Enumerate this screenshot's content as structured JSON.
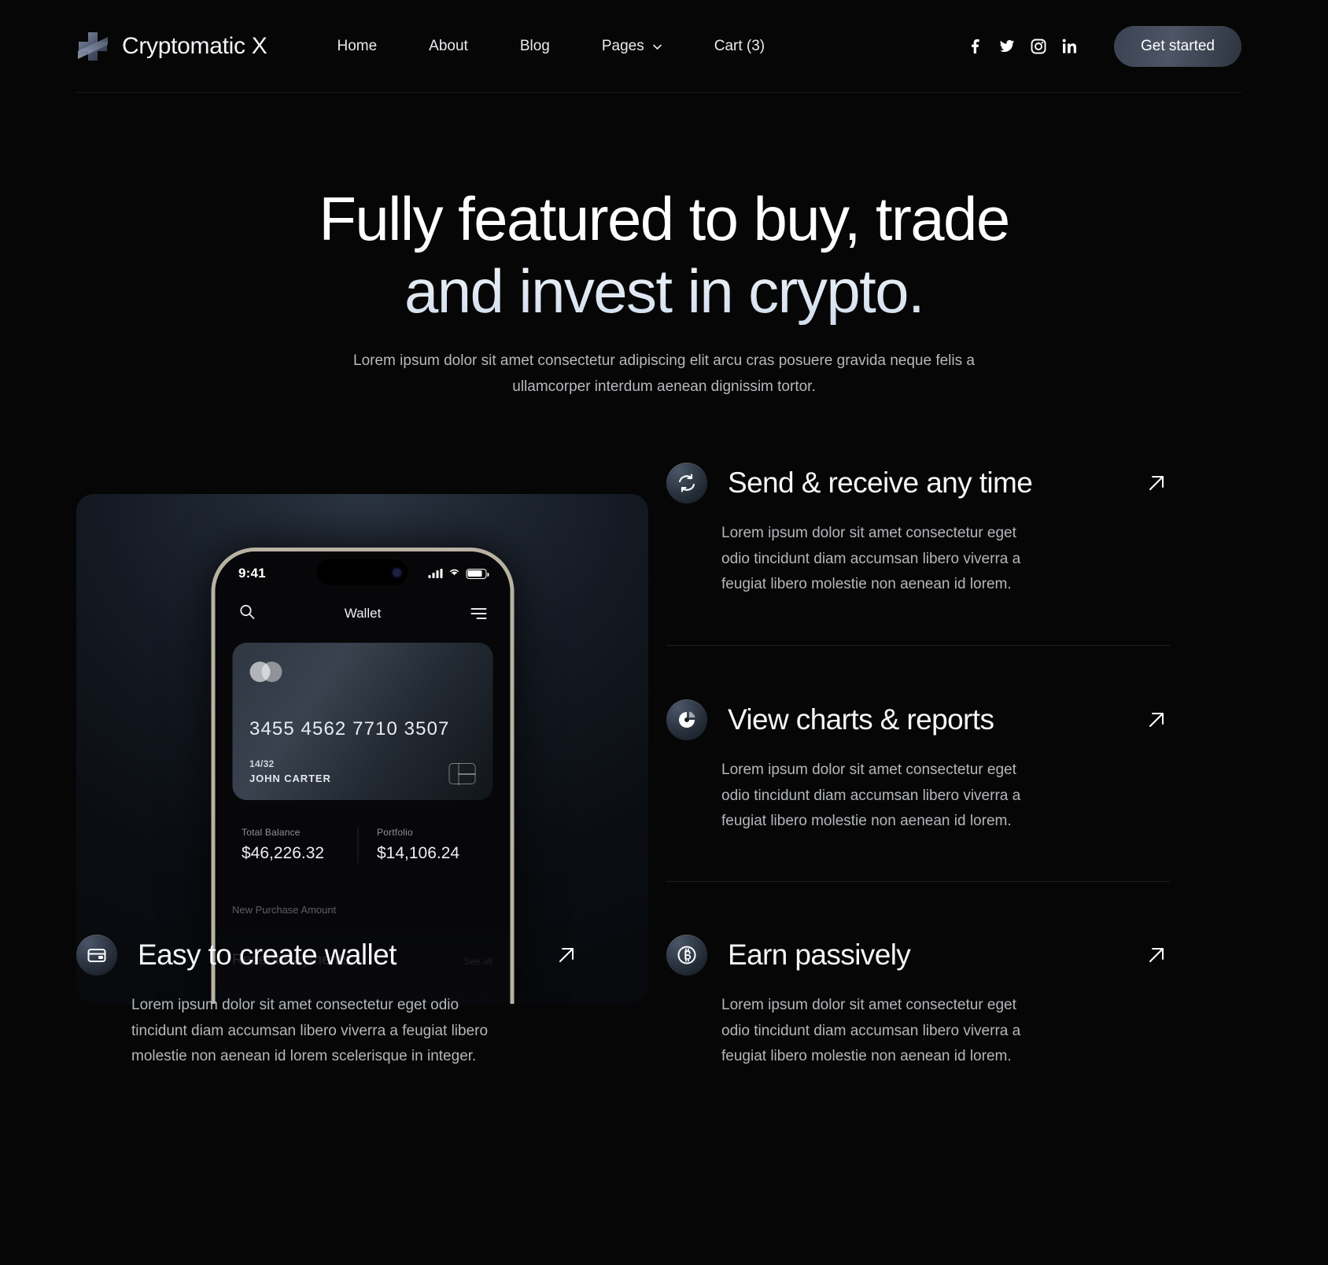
{
  "brand": {
    "name": "Cryptomatic X",
    "logo_icon": "logo-cross-slash"
  },
  "nav": {
    "links": [
      {
        "label": "Home",
        "has_dropdown": false
      },
      {
        "label": "About",
        "has_dropdown": false
      },
      {
        "label": "Blog",
        "has_dropdown": false
      },
      {
        "label": "Pages",
        "has_dropdown": true
      },
      {
        "label": "Cart (3)",
        "has_dropdown": false
      }
    ],
    "socials": [
      {
        "name": "facebook-icon",
        "glyph": "f"
      },
      {
        "name": "twitter-icon",
        "glyph": "t"
      },
      {
        "name": "instagram-icon",
        "glyph": "i"
      },
      {
        "name": "linkedin-icon",
        "glyph": "in"
      }
    ],
    "cta_label": "Get started"
  },
  "hero": {
    "heading_line1": "Fully featured to buy, trade",
    "heading_line2": "and invest in crypto.",
    "subtitle": "Lorem ipsum dolor sit amet consectetur adipiscing elit arcu cras posuere gravida neque felis a ullamcorper interdum aenean dignissim tortor."
  },
  "phone": {
    "status": {
      "time": "9:41"
    },
    "app_title": "Wallet",
    "search_icon": "search-icon",
    "menu_icon": "hamburger-icon",
    "card": {
      "number": "3455 4562 7710 3507",
      "expiry": "14/32",
      "holder": "JOHN CARTER"
    },
    "stats": [
      {
        "label": "Total Balance",
        "value": "$46,226.32"
      },
      {
        "label": "Portfolio",
        "value": "$14,106.24"
      }
    ],
    "new_purchase_label": "New Purchase Amount",
    "recent_payments_label": "Recent Payments",
    "see_all_label": "See all"
  },
  "features": [
    {
      "icon": "sync-refresh-icon",
      "title": "Send & receive any time",
      "body": "Lorem ipsum dolor sit amet consectetur eget odio tincidunt diam accumsan libero viverra a feugiat libero molestie non aenean id lorem.",
      "arrow": "arrow-up-right-icon"
    },
    {
      "icon": "pie-chart-icon",
      "title": "View charts & reports",
      "body": "Lorem ipsum dolor sit amet consectetur eget odio tincidunt diam accumsan libero viverra a feugiat libero molestie non aenean id lorem.",
      "arrow": "arrow-up-right-icon"
    },
    {
      "icon": "wallet-icon",
      "title": "Easy to create wallet",
      "body": "Lorem ipsum dolor sit amet consectetur eget odio tincidunt diam accumsan libero viverra a feugiat libero molestie non aenean id lorem scelerisque in integer.",
      "arrow": "arrow-up-right-icon"
    },
    {
      "icon": "bitcoin-icon",
      "title": "Earn passively",
      "body": "Lorem ipsum dolor sit amet consectetur eget odio tincidunt diam accumsan libero viverra a feugiat libero molestie non aenean id lorem.",
      "arrow": "arrow-up-right-icon"
    }
  ],
  "colors": {
    "background": "#060606",
    "text_primary": "#f4f6f9",
    "text_secondary": "#b4b7bb",
    "accent": "#4d5566"
  }
}
